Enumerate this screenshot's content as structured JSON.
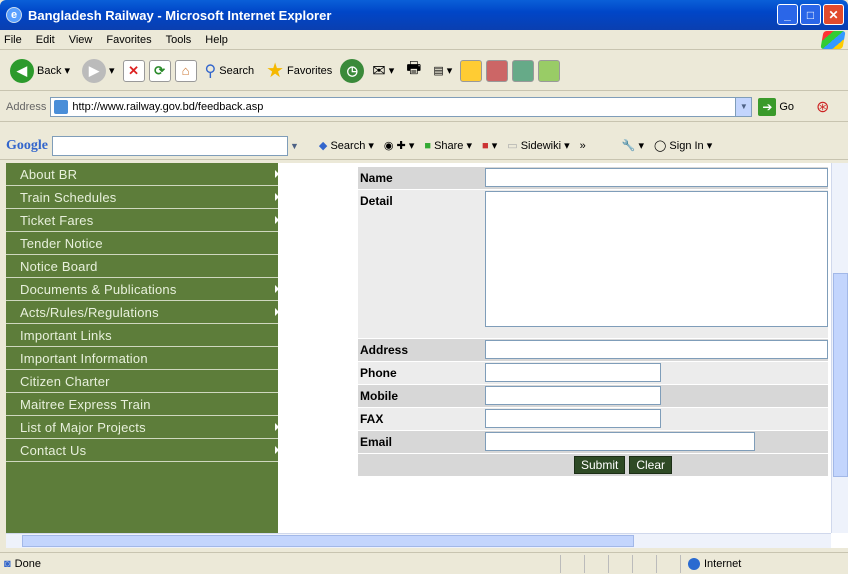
{
  "window": {
    "title": "Bangladesh Railway - Microsoft Internet Explorer"
  },
  "menu": [
    "File",
    "Edit",
    "View",
    "Favorites",
    "Tools",
    "Help"
  ],
  "toolbar": {
    "back": "Back",
    "search": "Search",
    "favorites": "Favorites"
  },
  "address": {
    "label": "Address",
    "url": "http://www.railway.gov.bd/feedback.asp",
    "go": "Go"
  },
  "google": {
    "logo": "Google",
    "search": "Search",
    "share": "Share",
    "sidewiki": "Sidewiki",
    "more": "»",
    "signin": "Sign In"
  },
  "sidebar": {
    "items": [
      {
        "label": "About BR",
        "arrow": true
      },
      {
        "label": "Train Schedules",
        "arrow": true
      },
      {
        "label": "Ticket Fares",
        "arrow": true
      },
      {
        "label": "Tender Notice",
        "arrow": false
      },
      {
        "label": "Notice Board",
        "arrow": false
      },
      {
        "label": "Documents & Publications",
        "arrow": true
      },
      {
        "label": "Acts/Rules/Regulations",
        "arrow": true
      },
      {
        "label": "Important Links",
        "arrow": false
      },
      {
        "label": "Important Information",
        "arrow": false
      },
      {
        "label": "Citizen Charter",
        "arrow": false
      },
      {
        "label": "Maitree Express Train",
        "arrow": false
      },
      {
        "label": "List of Major Projects",
        "arrow": true
      },
      {
        "label": "Contact Us",
        "arrow": true
      }
    ]
  },
  "form": {
    "name": "Name",
    "detail": "Detail",
    "address": "Address",
    "phone": "Phone",
    "mobile": "Mobile",
    "fax": "FAX",
    "email": "Email",
    "submit": "Submit",
    "clear": "Clear"
  },
  "status": {
    "text": "Done",
    "zone": "Internet"
  },
  "colors": {
    "sidebar": "#5d7d3a",
    "button": "#2e4a25"
  }
}
